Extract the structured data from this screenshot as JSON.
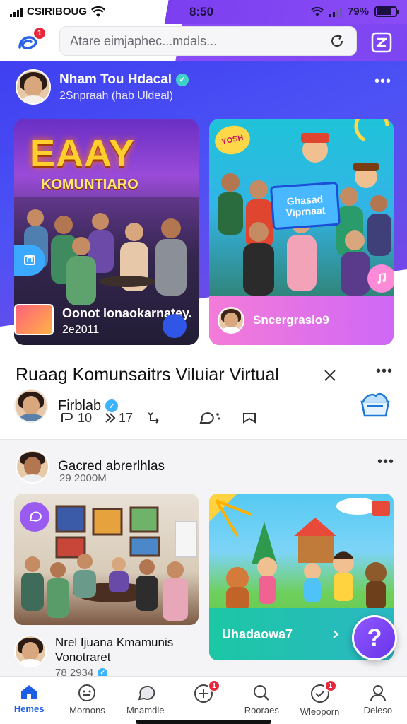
{
  "status_bar": {
    "carrier": "CSIRIBOUG",
    "time": "8:50",
    "battery": "79%",
    "battery_level": 0.79
  },
  "header": {
    "notification_count": "1",
    "search_placeholder": "Atare eimjaphec...mdals..."
  },
  "hero": {
    "author_name": "Nham Tou Hdacal",
    "author_subtitle": "2Snpraah (hab Uldeal)",
    "card_left": {
      "title": "EAAY",
      "subtitle": "KOMUNTIARO",
      "caption_title": "Oonot lonaokarnatey.",
      "caption_sub": "2e2011"
    },
    "card_right": {
      "sign_text": "Ghasad Viprnaat",
      "badge_text": "YOSH",
      "footer_text": "Sncergraslo9"
    }
  },
  "post1": {
    "title": "Ruaag Komunsaitrs Viluiar Virtual",
    "author": "Firblab",
    "actions": [
      {
        "icon": "reply-icon",
        "count": "10"
      },
      {
        "icon": "share-icon",
        "count": "17"
      },
      {
        "icon": "repost-icon",
        "count": ""
      },
      {
        "icon": "comment-icon",
        "count": ""
      },
      {
        "icon": "bookmark-icon",
        "count": ""
      }
    ]
  },
  "post2": {
    "author": "Gacred abrerlhlas",
    "subtitle": "29 2000M",
    "right_card_footer": "Uhadaowa7",
    "second_author_line1": "Nrel Ijuana Kmamunis",
    "second_author_line2": "Vonotraret",
    "second_author_sub": "78 2934"
  },
  "fab_label": "?",
  "bottom_nav": [
    {
      "label": "Hemes",
      "icon": "home-icon",
      "badge": ""
    },
    {
      "label": "Mornons",
      "icon": "smiley-icon",
      "badge": ""
    },
    {
      "label": "Mnamdle",
      "icon": "chat-icon",
      "badge": ""
    },
    {
      "label": "",
      "icon": "add-icon",
      "badge": "1"
    },
    {
      "label": "Rooraes",
      "icon": "search-icon",
      "badge": ""
    },
    {
      "label": "Wleoporn",
      "icon": "check-icon",
      "badge": "1"
    },
    {
      "label": "Deleso",
      "icon": "profile-icon",
      "badge": ""
    }
  ],
  "colors": {
    "accent": "#7b3ff0",
    "hero_blue": "#4c52f5",
    "active_nav": "#1d5ee6",
    "badge": "#e8283a"
  }
}
